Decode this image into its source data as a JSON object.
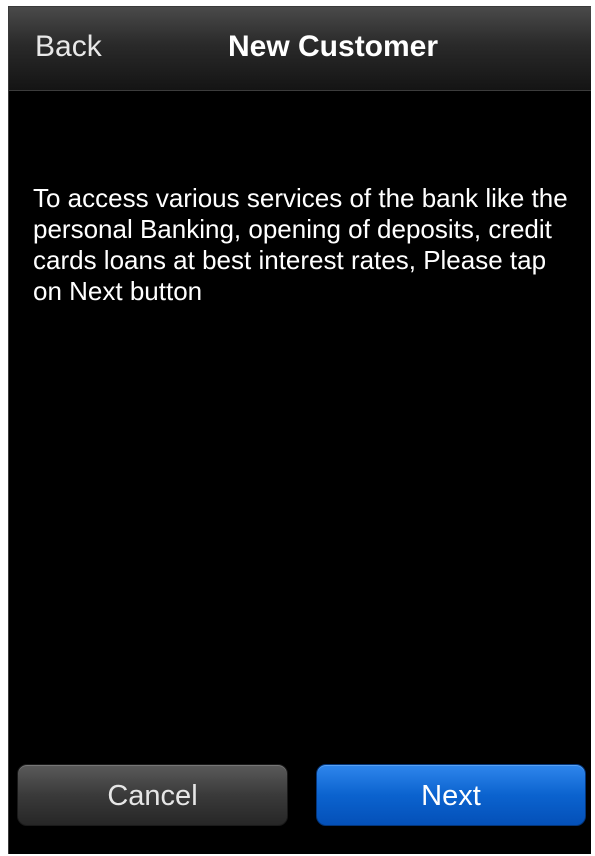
{
  "nav": {
    "back_label": "Back",
    "title": "New Customer"
  },
  "content": {
    "message": "To access various services of the bank like the personal Banking, opening of deposits, credit cards loans at best interest rates, Please tap on Next button"
  },
  "actions": {
    "cancel_label": "Cancel",
    "next_label": "Next"
  },
  "colors": {
    "background": "#000000",
    "primary_button": "#0b63cf",
    "secondary_button": "#3a3a3a",
    "text": "#ffffff"
  }
}
